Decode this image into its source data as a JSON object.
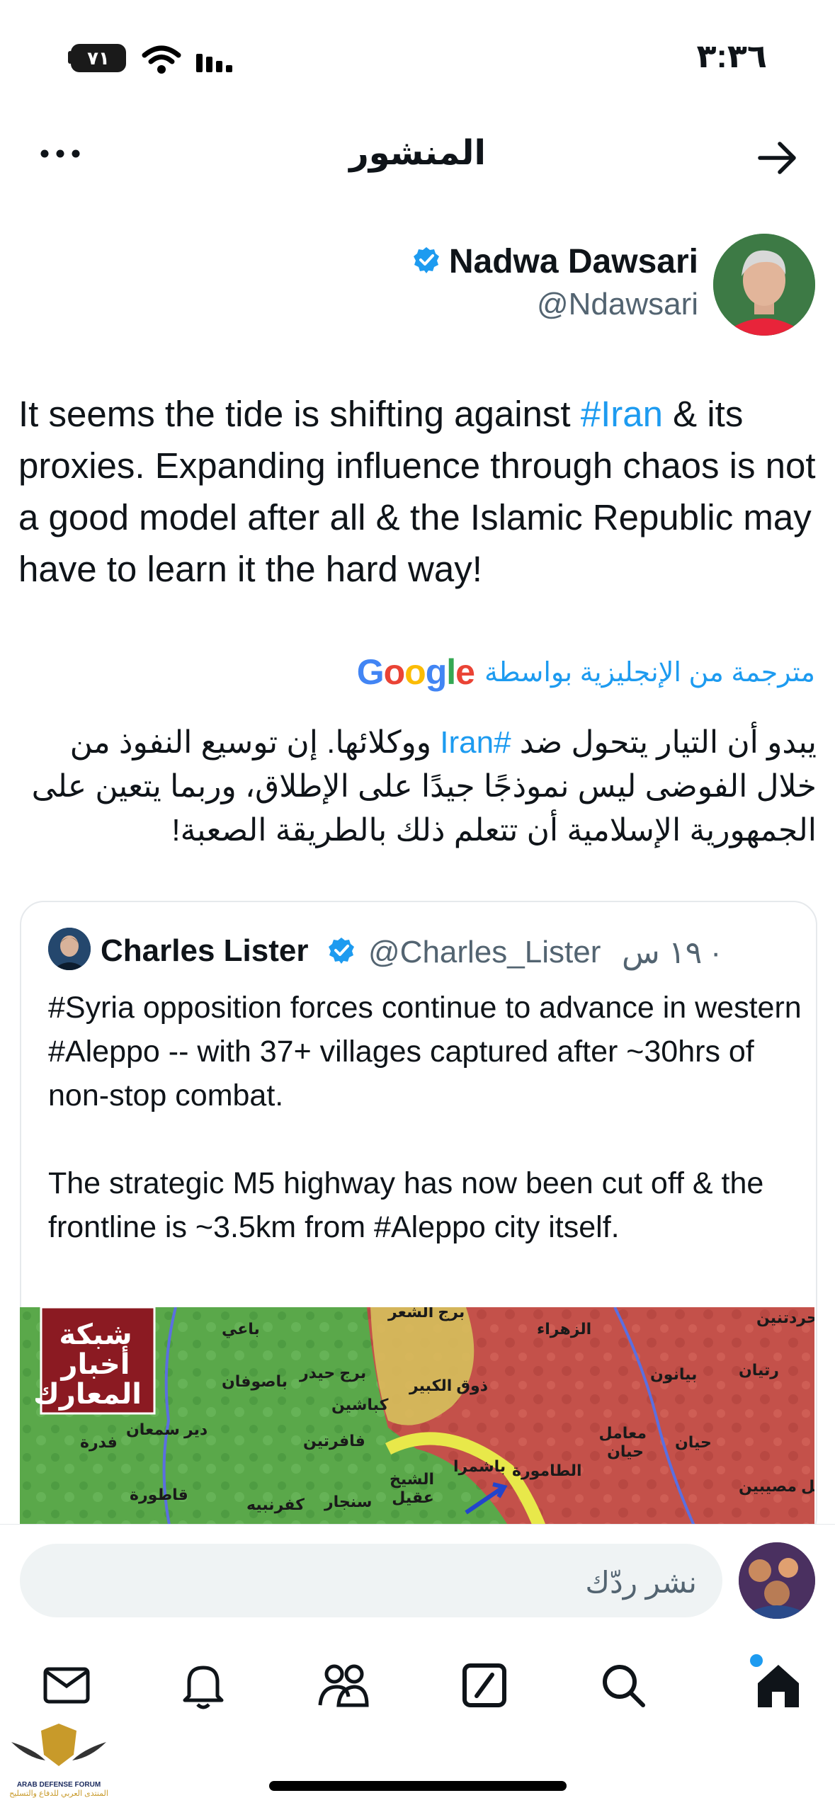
{
  "status_bar": {
    "time": "٣:٣٦",
    "battery": "٧١"
  },
  "header": {
    "title": "المنشور"
  },
  "author": {
    "name": "Nadwa Dawsari",
    "handle": "@Ndawsari"
  },
  "tweet": {
    "text_before": "It seems the tide is shifting against ",
    "hashtag": "#Iran",
    "text_after": " & its proxies. Expanding influence through chaos is not a good model after all & the Islamic Republic may have to learn it the hard way!"
  },
  "translation": {
    "label": "مترجمة من الإنجليزية بواسطة",
    "google_letters": [
      "G",
      "o",
      "o",
      "g",
      "l",
      "e"
    ],
    "google_colors": [
      "#4285F4",
      "#EA4335",
      "#FBBC05",
      "#4285F4",
      "#34A853",
      "#EA4335"
    ],
    "text_before": "يبدو أن التيار يتحول ضد ",
    "hashtag": "#Iran",
    "text_after": " ووكلائها. إن توسيع النفوذ من خلال الفوضى ليس نموذجًا جيدًا على الإطلاق، وربما يتعين على الجمهورية الإسلامية أن تتعلم ذلك بالطريقة الصعبة!"
  },
  "quote": {
    "name": "Charles Lister",
    "handle": "@Charles_Lister",
    "time": "· ١٩ س",
    "text": "#Syria opposition forces continue to advance in western #Aleppo -- with 37+ villages captured after ~30hrs of non-stop combat.\n\nThe strategic M5 highway has now been cut off & the frontline is ~3.5km from #Aleppo city itself."
  },
  "map": {
    "logo": "شبكة أخبار المعارك",
    "labels": [
      "باعي",
      "برج حيدر",
      "باصوفان",
      "كباشين",
      "فافرتين",
      "دير سمعان",
      "فدرة",
      "قاطورة",
      "كفرنبيه",
      "سنجار",
      "الشيخ عقيل",
      "باشمرا",
      "الطامورة",
      "ذوق الكبير",
      "الزهراء",
      "بيانون",
      "حيان",
      "معامل حيان",
      "رتيان",
      "حردتنين",
      "تل مصيبين",
      "برج الشعر"
    ]
  },
  "reply": {
    "placeholder": "نشر ردّك"
  },
  "watermark": {
    "line1": "ARAB DEFENSE FORUM",
    "line2": "المنتدى العربي للدفاع والتسليح"
  },
  "colors": {
    "accent": "#1d9bf0",
    "text": "#0f1419",
    "muted": "#536471"
  }
}
